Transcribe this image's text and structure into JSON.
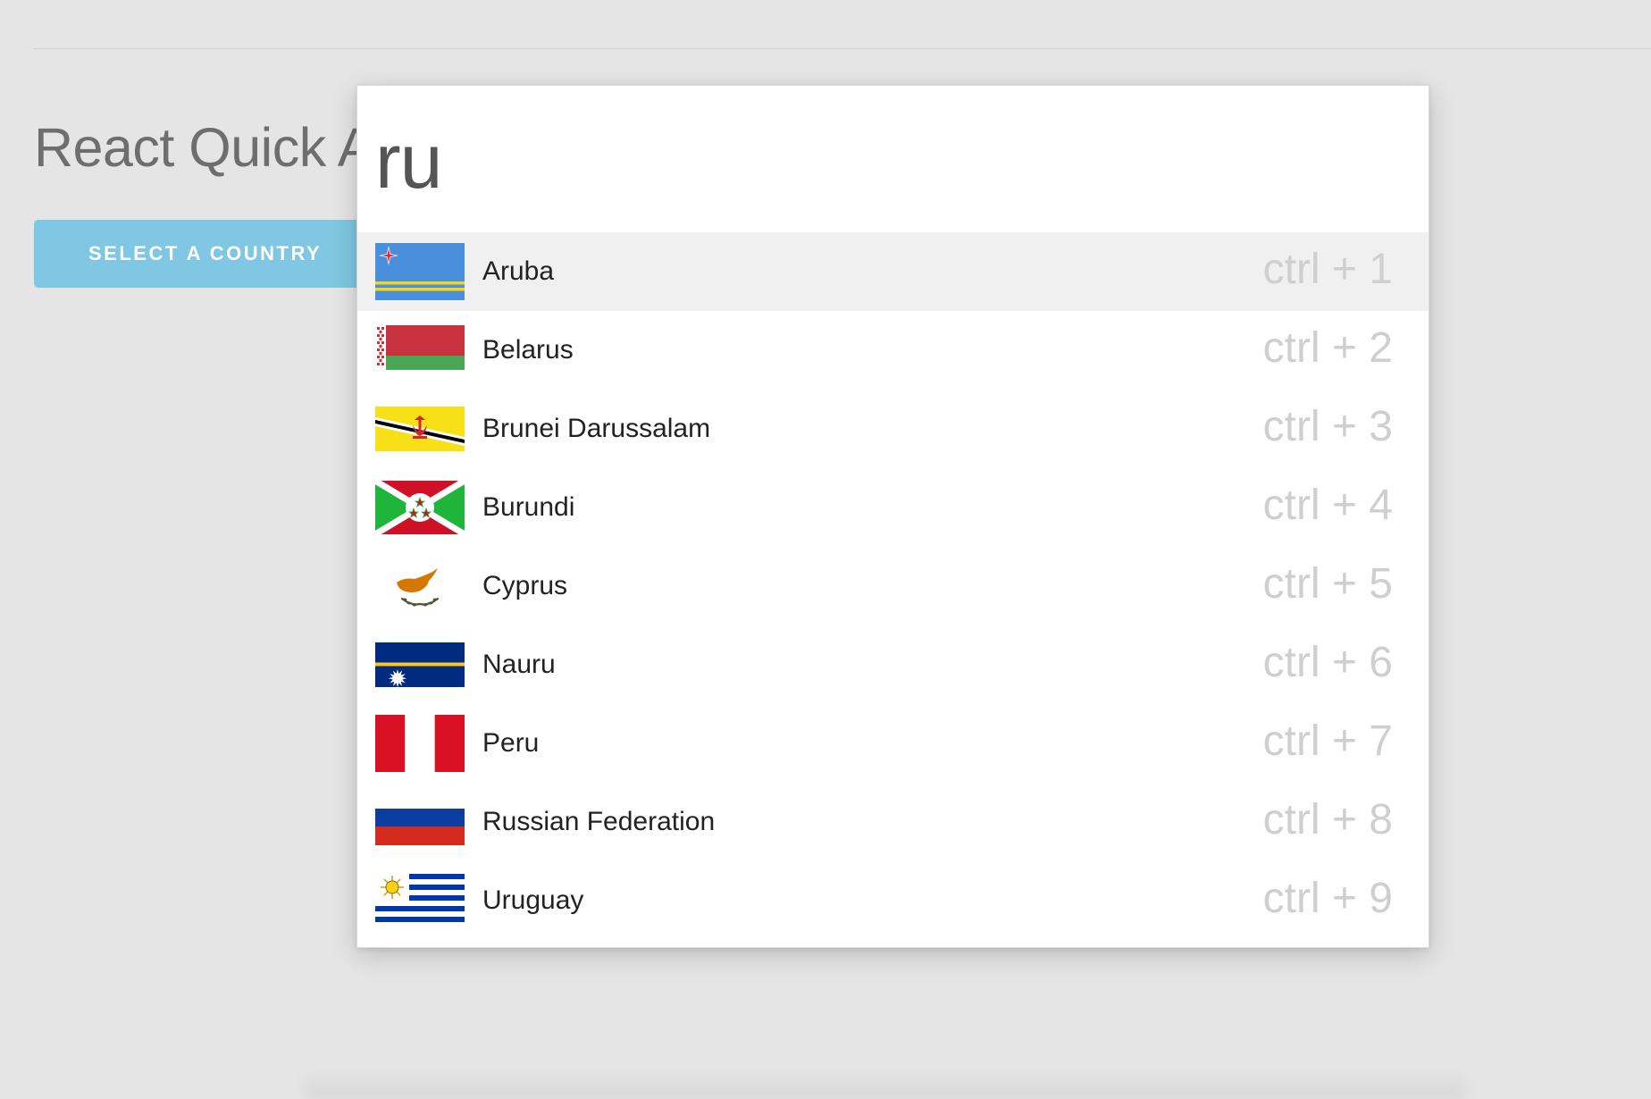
{
  "page": {
    "title": "React Quick A",
    "select_button_label": "SELECT A COUNTRY"
  },
  "palette": {
    "query": "ru",
    "results": [
      {
        "name": "Aruba",
        "shortcut": "ctrl + 1",
        "flag_icon": "aruba-flag-icon"
      },
      {
        "name": "Belarus",
        "shortcut": "ctrl + 2",
        "flag_icon": "belarus-flag-icon"
      },
      {
        "name": "Brunei Darussalam",
        "shortcut": "ctrl + 3",
        "flag_icon": "brunei-flag-icon"
      },
      {
        "name": "Burundi",
        "shortcut": "ctrl + 4",
        "flag_icon": "burundi-flag-icon"
      },
      {
        "name": "Cyprus",
        "shortcut": "ctrl + 5",
        "flag_icon": "cyprus-flag-icon"
      },
      {
        "name": "Nauru",
        "shortcut": "ctrl + 6",
        "flag_icon": "nauru-flag-icon"
      },
      {
        "name": "Peru",
        "shortcut": "ctrl + 7",
        "flag_icon": "peru-flag-icon"
      },
      {
        "name": "Russian Federation",
        "shortcut": "ctrl + 8",
        "flag_icon": "russia-flag-icon"
      },
      {
        "name": "Uruguay",
        "shortcut": "ctrl + 9",
        "flag_icon": "uruguay-flag-icon"
      }
    ]
  },
  "colors": {
    "background": "#e5e5e5",
    "button": "#7fc7e2",
    "active_row": "#f0f0f0",
    "shortcut_text": "#cfcfcf"
  }
}
